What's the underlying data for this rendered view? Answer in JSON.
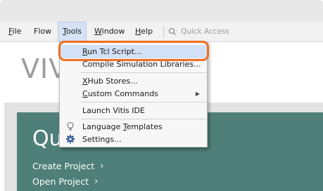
{
  "menubar": {
    "items": [
      {
        "mnemonic": "F",
        "rest": "ile"
      },
      {
        "mnemonic": "",
        "rest": "Flow"
      },
      {
        "mnemonic": "T",
        "rest": "ools"
      },
      {
        "mnemonic": "W",
        "rest": "indow"
      },
      {
        "mnemonic": "H",
        "rest": "elp"
      }
    ],
    "active_menu": "Tools"
  },
  "quick_access": {
    "placeholder": "Quick Access",
    "icon": "search-icon"
  },
  "brand": {
    "text": "VIVADO"
  },
  "quick_start": {
    "title": "Quick Start",
    "links": [
      {
        "label": "Create Project"
      },
      {
        "label": "Open Project"
      }
    ]
  },
  "tools_menu": {
    "items": [
      {
        "pre": "",
        "mn": "R",
        "post": "un Tcl Script...",
        "highlighted": true
      },
      {
        "pre": "Compile Simulation Libraries...",
        "mn": "",
        "post": ""
      },
      {
        "pre": "",
        "mn": "X",
        "post": "Hub Stores..."
      },
      {
        "pre": "",
        "mn": "C",
        "post": "ustom Commands",
        "has_submenu": true
      },
      {
        "pre": "Launch Vitis IDE",
        "mn": "",
        "post": ""
      },
      {
        "pre": "Language ",
        "mn": "T",
        "post": "emplates",
        "icon": "lightbulb-icon"
      },
      {
        "pre": "Settings...",
        "mn": "",
        "post": "",
        "icon": "gear-icon"
      }
    ]
  },
  "colors": {
    "callout": "#f07020",
    "teal": "#4f7f79",
    "menu_highlight": "#d2e1f6"
  }
}
